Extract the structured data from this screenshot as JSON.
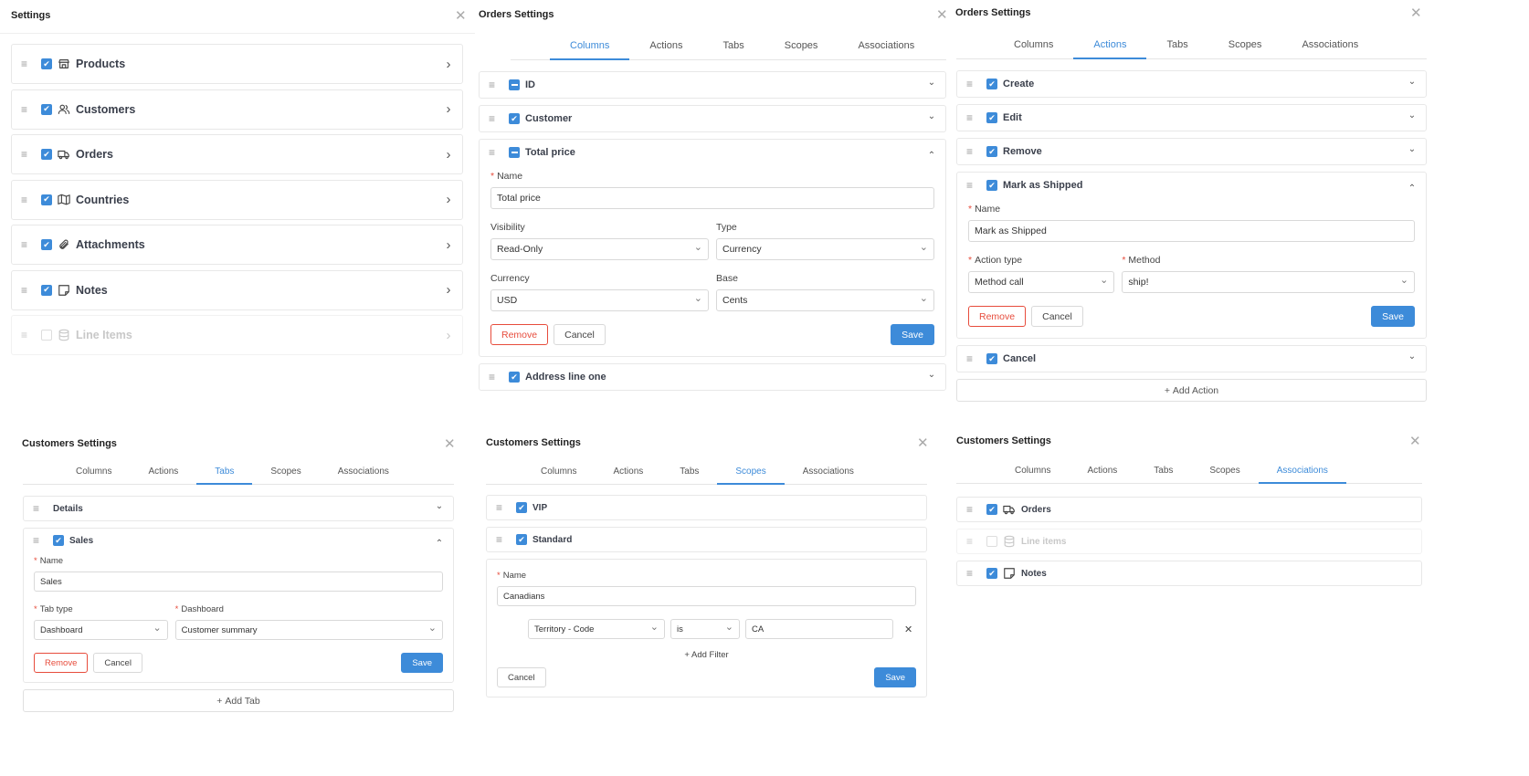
{
  "colors": {
    "accent": "#3d8bd9",
    "danger": "#e74c3c"
  },
  "panels": [
    {
      "title": "Settings",
      "items": [
        {
          "label": "Products",
          "check": "checked",
          "icon": "store-icon",
          "chevron": "right"
        },
        {
          "label": "Customers",
          "check": "checked",
          "icon": "users-icon",
          "chevron": "right"
        },
        {
          "label": "Orders",
          "check": "checked",
          "icon": "truck-icon",
          "chevron": "right"
        },
        {
          "label": "Countries",
          "check": "checked",
          "icon": "map-icon",
          "chevron": "right"
        },
        {
          "label": "Attachments",
          "check": "checked",
          "icon": "paperclip-icon",
          "chevron": "right"
        },
        {
          "label": "Notes",
          "check": "checked",
          "icon": "note-icon",
          "chevron": "right"
        },
        {
          "label": "Line Items",
          "check": "unchecked",
          "icon": "database-icon",
          "chevron": "right",
          "disabled": true
        }
      ]
    },
    {
      "title": "Orders Settings",
      "tabs": [
        "Columns",
        "Actions",
        "Tabs",
        "Scopes",
        "Associations"
      ],
      "active_tab": "Columns",
      "items": [
        {
          "label": "ID",
          "check": "indeterminate",
          "chevron": "down"
        },
        {
          "label": "Customer",
          "check": "checked",
          "chevron": "down"
        },
        {
          "label": "Total price",
          "check": "indeterminate",
          "chevron": "up",
          "form": {
            "rows": [
              [
                {
                  "label": "Name",
                  "required": true,
                  "value": "Total price",
                  "kind": "input"
                }
              ],
              [
                {
                  "label": "Visibility",
                  "value": "Read-Only",
                  "kind": "select"
                },
                {
                  "label": "Type",
                  "value": "Currency",
                  "kind": "select"
                }
              ],
              [
                {
                  "label": "Currency",
                  "value": "USD",
                  "kind": "select"
                },
                {
                  "label": "Base",
                  "value": "Cents",
                  "kind": "select"
                }
              ]
            ],
            "buttons": {
              "remove": "Remove",
              "cancel": "Cancel",
              "save": "Save"
            }
          }
        },
        {
          "label": "Address line one",
          "check": "checked",
          "chevron": "down"
        }
      ]
    },
    {
      "title": "Orders Settings",
      "tabs": [
        "Columns",
        "Actions",
        "Tabs",
        "Scopes",
        "Associations"
      ],
      "active_tab": "Actions",
      "items": [
        {
          "label": "Create",
          "check": "checked",
          "chevron": "down"
        },
        {
          "label": "Edit",
          "check": "checked",
          "chevron": "down"
        },
        {
          "label": "Remove",
          "check": "checked",
          "chevron": "down"
        },
        {
          "label": "Mark as Shipped",
          "check": "checked",
          "chevron": "up",
          "form": {
            "rows": [
              [
                {
                  "label": "Name",
                  "required": true,
                  "value": "Mark as Shipped",
                  "kind": "input"
                }
              ],
              [
                {
                  "label": "Action type",
                  "required": true,
                  "value": "Method call",
                  "kind": "select"
                },
                {
                  "label": "Method",
                  "required": true,
                  "value": "ship!",
                  "kind": "select",
                  "grow": 2
                }
              ]
            ],
            "buttons": {
              "remove": "Remove",
              "cancel": "Cancel",
              "save": "Save"
            }
          }
        },
        {
          "label": "Cancel",
          "check": "checked",
          "chevron": "down"
        }
      ],
      "add_button": "Add Action"
    },
    {
      "title": "Customers Settings",
      "tabs": [
        "Columns",
        "Actions",
        "Tabs",
        "Scopes",
        "Associations"
      ],
      "active_tab": "Tabs",
      "items": [
        {
          "label": "Details",
          "check": "none",
          "chevron": "down"
        },
        {
          "label": "Sales",
          "check": "checked",
          "chevron": "up",
          "form": {
            "rows": [
              [
                {
                  "label": "Name",
                  "required": true,
                  "value": "Sales",
                  "kind": "input"
                }
              ],
              [
                {
                  "label": "Tab type",
                  "required": true,
                  "value": "Dashboard",
                  "kind": "select"
                },
                {
                  "label": "Dashboard",
                  "required": true,
                  "value": "Customer summary",
                  "kind": "select",
                  "grow": 2
                }
              ]
            ],
            "buttons": {
              "remove": "Remove",
              "cancel": "Cancel",
              "save": "Save"
            }
          }
        }
      ],
      "add_button": "Add Tab"
    },
    {
      "title": "Customers Settings",
      "tabs": [
        "Columns",
        "Actions",
        "Tabs",
        "Scopes",
        "Associations"
      ],
      "active_tab": "Scopes",
      "items": [
        {
          "label": "VIP",
          "check": "checked"
        },
        {
          "label": "Standard",
          "check": "checked"
        },
        {
          "headerless": true,
          "form": {
            "rows": [
              [
                {
                  "label": "Name",
                  "required": true,
                  "value": "Canadians",
                  "kind": "input"
                }
              ]
            ],
            "filters": [
              {
                "field": "Territory - Code",
                "operator": "is",
                "value": "CA"
              }
            ],
            "add_filter": "Add Filter",
            "buttons": {
              "cancel": "Cancel",
              "save": "Save"
            }
          }
        }
      ]
    },
    {
      "title": "Customers Settings",
      "tabs": [
        "Columns",
        "Actions",
        "Tabs",
        "Scopes",
        "Associations"
      ],
      "active_tab": "Associations",
      "items": [
        {
          "label": "Orders",
          "check": "checked",
          "icon": "truck-icon"
        },
        {
          "label": "Line items",
          "check": "unchecked",
          "icon": "database-icon",
          "disabled": true
        },
        {
          "label": "Notes",
          "check": "checked",
          "icon": "note-icon"
        }
      ]
    }
  ]
}
